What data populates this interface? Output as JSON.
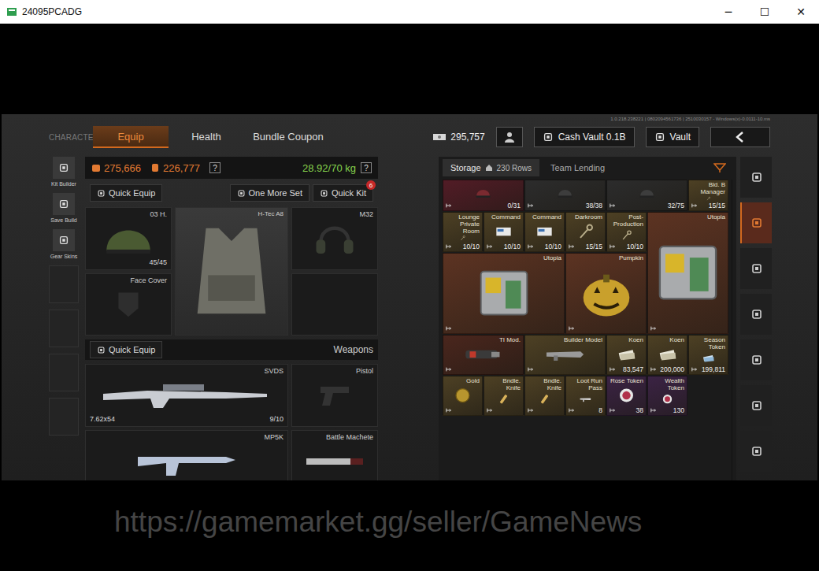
{
  "window": {
    "title": "24095PCADG",
    "controls": [
      "─",
      "☐",
      "✕"
    ]
  },
  "version": "1.0.218.238221 | 0802094561736 | 2510030157 - Windows(x)-0.0111-10.ms",
  "nav": {
    "section": "CHARACTER",
    "tabs": [
      {
        "label": "Equip",
        "selected": true
      },
      {
        "label": "Health",
        "selected": false
      },
      {
        "label": "Bundle Coupon",
        "selected": false
      }
    ]
  },
  "wallet": {
    "cash": "295,757",
    "cash_vault": "Cash Vault 0.1B",
    "vault": "Vault"
  },
  "sidebar": {
    "items": [
      {
        "kind": "button",
        "label": "Kit Builder"
      },
      {
        "kind": "button",
        "label": "Save Build"
      },
      {
        "kind": "button",
        "label": "Gear Skins"
      },
      {
        "kind": "slot"
      },
      {
        "kind": "slot"
      },
      {
        "kind": "slot"
      },
      {
        "kind": "slot"
      }
    ]
  },
  "stats": {
    "value": "275,666",
    "carry": "226,777",
    "help": "?",
    "weight": "28.92/70 kg"
  },
  "actions": {
    "quick_equip": "Quick Equip",
    "one_more_set": "One More Set",
    "quick_kit": "Quick Kit",
    "quick_kit_badge": "6"
  },
  "gear": {
    "helmet": {
      "label": "03 H.",
      "count": "45/45"
    },
    "armor": {
      "label": "H-Tec A8"
    },
    "headset": {
      "label": "M32"
    },
    "face": {
      "label": "Face Cover"
    }
  },
  "weapons": {
    "quick_equip": "Quick Equip",
    "title": "Weapons",
    "primary": {
      "label": "SVDS",
      "ammo": "7.62x54",
      "count": "9/10"
    },
    "pistol": {
      "label": "Pistol"
    },
    "secondary": {
      "label": "MP5K"
    },
    "melee": {
      "label": "Battle Machete"
    }
  },
  "storage": {
    "tabs": [
      {
        "label": "Storage",
        "rows": "230 Rows",
        "selected": true
      },
      {
        "label": "Team Lending",
        "selected": false
      }
    ],
    "scroll_level": 0.88,
    "items": [
      {
        "kind": "gear",
        "label": "",
        "count": "0/31",
        "color": "#521c26"
      },
      {
        "kind": "helmet",
        "label": "",
        "count": "38/38",
        "color": "#2c2c2c"
      },
      {
        "kind": "helmet",
        "label": "",
        "count": "32/75",
        "color": "#2c2c2c"
      },
      {
        "kind": "key",
        "label": "Bld. B Manager",
        "count": "15/15",
        "color": "#4d4024"
      },
      {
        "kind": "key",
        "label": "Lounge Private Room",
        "count": "10/10",
        "color": "#4d4024"
      },
      {
        "kind": "card",
        "label": "Command",
        "count": "10/10",
        "color": "#4d4024"
      },
      {
        "kind": "card",
        "label": "Command",
        "count": "10/10",
        "color": "#4d4024"
      },
      {
        "kind": "key",
        "label": "Darkroom",
        "count": "15/15",
        "color": "#4d4024"
      },
      {
        "kind": "key",
        "label": "Post-Production",
        "count": "10/10",
        "color": "#4d4024"
      },
      {
        "kind": "locker",
        "label": "Utopia",
        "count": "",
        "color": "#5c3322"
      },
      {
        "kind": "crate",
        "label": "Utopia",
        "count": "",
        "color": "#5c3322"
      },
      {
        "kind": "pumpkin",
        "label": "Pumpkin",
        "count": "",
        "color": "#5c3322"
      },
      {
        "kind": "device",
        "label": "TI Mod.",
        "count": "",
        "color": "#4a261d"
      },
      {
        "kind": "blueprint",
        "label": "Builder Model",
        "count": "",
        "color": "#4d4024"
      },
      {
        "kind": "cash",
        "label": "Koen",
        "count": "83,547",
        "color": "#4d4024"
      },
      {
        "kind": "cash",
        "label": "Koen",
        "count": "200,000",
        "color": "#4d4024"
      },
      {
        "kind": "ticket",
        "label": "Season Token",
        "count": "199,811",
        "color": "#4d4024"
      },
      {
        "kind": "coin",
        "label": "Gold",
        "count": "",
        "color": "#4d4024"
      },
      {
        "kind": "bar",
        "label": "Bndle. Knife",
        "count": "",
        "color": "#4d4024"
      },
      {
        "kind": "bar",
        "label": "Bndle. Knife",
        "count": "",
        "color": "#4d4024"
      },
      {
        "kind": "pass",
        "label": "Loot Run Pass",
        "count": "8",
        "color": "#4d4024"
      },
      {
        "kind": "token",
        "label": "Rose Token",
        "count": "38",
        "color": "#3b2344"
      },
      {
        "kind": "token",
        "label": "Wealth Token",
        "count": "130",
        "color": "#3b2344"
      }
    ]
  },
  "rail": {
    "items": [
      {
        "kind": "stack",
        "selected": false
      },
      {
        "kind": "chest",
        "selected": true
      },
      {
        "kind": "bag",
        "selected": false
      },
      {
        "kind": "helmet",
        "selected": false
      },
      {
        "kind": "key",
        "selected": false
      },
      {
        "kind": "cash",
        "selected": false
      },
      {
        "kind": "box",
        "selected": false
      }
    ]
  },
  "watermark": "https://gamemarket.gg/seller/GameNews"
}
